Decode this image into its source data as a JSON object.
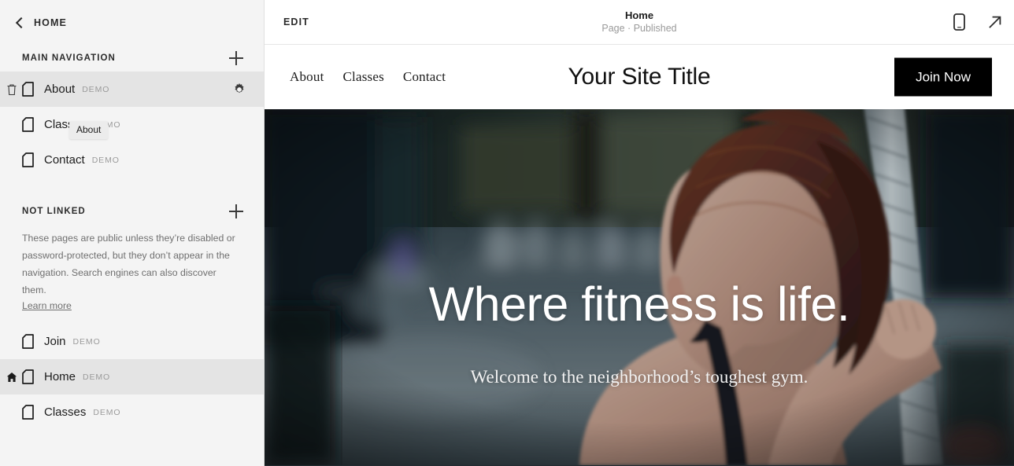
{
  "sidebar": {
    "back": {
      "label": "HOME",
      "icon": "chevron-left-icon"
    },
    "sections": [
      {
        "title": "MAIN NAVIGATION",
        "add_icon": "plus-icon",
        "items": [
          {
            "label": "About",
            "tag": "DEMO",
            "icon": "page-icon",
            "active": true,
            "lead_icon": "trash-icon",
            "trailing_icon": "gear-icon"
          },
          {
            "label": "Classes",
            "tag": "DEMO",
            "icon": "page-icon",
            "active": false,
            "lead_icon": "",
            "trailing_icon": ""
          },
          {
            "label": "Contact",
            "tag": "DEMO",
            "icon": "page-icon",
            "active": false,
            "lead_icon": "",
            "trailing_icon": ""
          }
        ]
      },
      {
        "title": "NOT LINKED",
        "add_icon": "plus-icon",
        "notice": "These pages are public unless they’re disabled or password-protected, but they don’t appear in the navigation. Search engines can also discover them.",
        "notice_link": "Learn more",
        "items": [
          {
            "label": "Join",
            "tag": "DEMO",
            "icon": "page-icon",
            "active": false,
            "lead_icon": "",
            "trailing_icon": ""
          },
          {
            "label": "Home",
            "tag": "DEMO",
            "icon": "page-icon",
            "active": true,
            "lead_icon": "home-icon",
            "trailing_icon": ""
          },
          {
            "label": "Classes",
            "tag": "DEMO",
            "icon": "page-icon",
            "active": false,
            "lead_icon": "",
            "trailing_icon": ""
          }
        ]
      }
    ],
    "tooltip": "About"
  },
  "topbar": {
    "edit_label": "EDIT",
    "title": "Home",
    "subtitle": "Page · Published",
    "mobile_icon": "mobile-preview-icon",
    "open_icon": "external-link-icon"
  },
  "site": {
    "nav": [
      {
        "label": "About"
      },
      {
        "label": "Classes"
      },
      {
        "label": "Contact"
      }
    ],
    "title": "Your Site Title",
    "cta_label": "Join Now",
    "hero": {
      "heading": "Where fitness is life.",
      "subheading": "Welcome to the neighborhood’s toughest gym."
    }
  },
  "colors": {
    "sidebar_bg": "#f4f4f4",
    "row_active": "#e4e4e4",
    "cta_bg": "#000000",
    "cta_fg": "#ffffff",
    "muted_text": "#9a9a9a",
    "body_text": "#1c1c1c"
  }
}
